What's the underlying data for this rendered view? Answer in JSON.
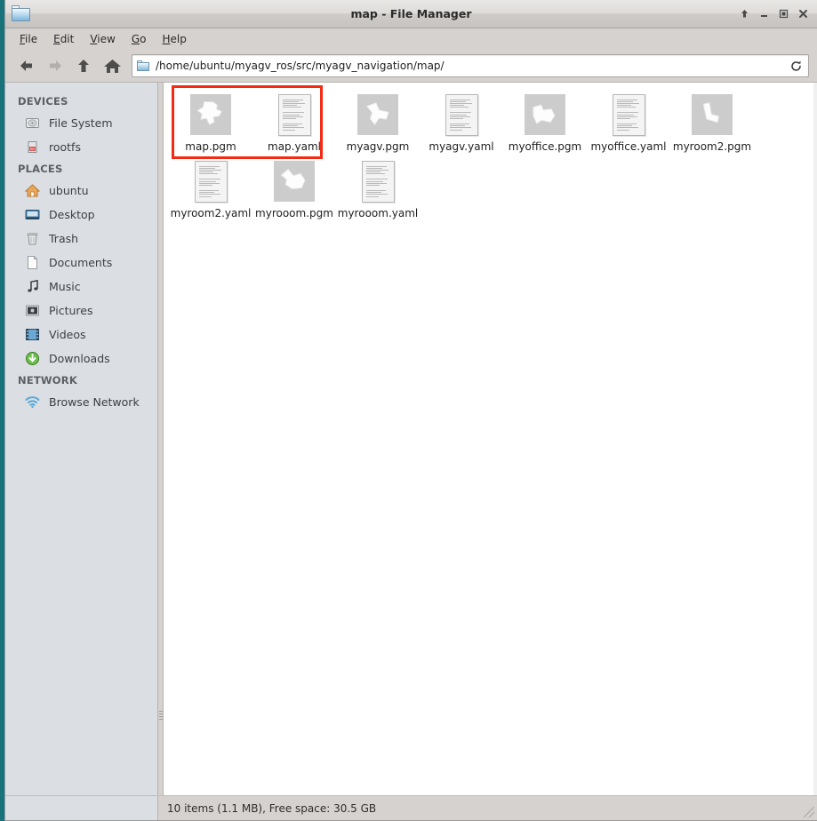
{
  "window": {
    "title": "map - File Manager",
    "icon": "folder-icon",
    "buttons": [
      {
        "name": "shade-button",
        "glyph": "arrow-up"
      },
      {
        "name": "minimize-button",
        "glyph": "minimize"
      },
      {
        "name": "maximize-button",
        "glyph": "maximize"
      },
      {
        "name": "close-button",
        "glyph": "close"
      }
    ]
  },
  "menubar": {
    "items": [
      {
        "mnemonic": "F",
        "rest": "ile"
      },
      {
        "mnemonic": "E",
        "rest": "dit"
      },
      {
        "mnemonic": "V",
        "rest": "iew"
      },
      {
        "mnemonic": "G",
        "rest": "o"
      },
      {
        "mnemonic": "H",
        "rest": "elp"
      }
    ]
  },
  "toolbar": {
    "back": {
      "label": "Back",
      "icon": "arrow-left-icon",
      "enabled": true
    },
    "forward": {
      "label": "Forward",
      "icon": "arrow-right-icon",
      "enabled": false
    },
    "up": {
      "label": "Up",
      "icon": "arrow-up-icon",
      "enabled": true
    },
    "home": {
      "label": "Home",
      "icon": "home-icon",
      "enabled": true
    },
    "reload": {
      "label": "Reload",
      "icon": "reload-icon"
    },
    "path": "/home/ubuntu/myagv_ros/src/myagv_navigation/map/",
    "path_placeholder": "/"
  },
  "sidebar": {
    "groups": [
      {
        "title": "DEVICES",
        "items": [
          {
            "label": "File System",
            "icon": "harddisk-icon"
          },
          {
            "label": "rootfs",
            "icon": "sdcard-icon"
          }
        ]
      },
      {
        "title": "PLACES",
        "items": [
          {
            "label": "ubuntu",
            "icon": "home-icon"
          },
          {
            "label": "Desktop",
            "icon": "desktop-icon"
          },
          {
            "label": "Trash",
            "icon": "trash-icon"
          },
          {
            "label": "Documents",
            "icon": "document-icon"
          },
          {
            "label": "Music",
            "icon": "music-note-icon"
          },
          {
            "label": "Pictures",
            "icon": "picture-icon"
          },
          {
            "label": "Videos",
            "icon": "film-icon"
          },
          {
            "label": "Downloads",
            "icon": "download-icon"
          }
        ]
      },
      {
        "title": "NETWORK",
        "items": [
          {
            "label": "Browse Network",
            "icon": "network-wifi-icon"
          }
        ]
      }
    ]
  },
  "files": [
    {
      "name": "map.pgm",
      "type": "pgm",
      "selected": true,
      "thumb": "map-thumbnail"
    },
    {
      "name": "map.yaml",
      "type": "yaml",
      "selected": true,
      "thumb": "text-document"
    },
    {
      "name": "myagv.pgm",
      "type": "pgm",
      "selected": false,
      "thumb": "map-thumbnail"
    },
    {
      "name": "myagv.yaml",
      "type": "yaml",
      "selected": false,
      "thumb": "text-document"
    },
    {
      "name": "myoffice.pgm",
      "type": "pgm",
      "selected": false,
      "thumb": "map-thumbnail"
    },
    {
      "name": "myoffice.yaml",
      "type": "yaml",
      "selected": false,
      "thumb": "text-document"
    },
    {
      "name": "myroom2.pgm",
      "type": "pgm",
      "selected": false,
      "thumb": "map-thumbnail"
    },
    {
      "name": "myroom2.yaml",
      "type": "yaml",
      "selected": false,
      "thumb": "text-document"
    },
    {
      "name": "myrooom.pgm",
      "type": "pgm",
      "selected": false,
      "thumb": "map-thumbnail"
    },
    {
      "name": "myrooom.yaml",
      "type": "yaml",
      "selected": false,
      "thumb": "text-document"
    }
  ],
  "annotation": {
    "name": "red-highlight-box",
    "color": "#f42b12",
    "covers": "map.pgm and map.yaml"
  },
  "statusbar": {
    "text": "10 items (1.1 MB), Free space: 30.5 GB",
    "item_count": 10,
    "total_size": "1.1 MB",
    "free_space": "30.5 GB"
  },
  "colors": {
    "desktop": "#17727a",
    "chrome": "#d6d2d0",
    "sidebar": "#dbdee3",
    "content": "#ffffff",
    "highlight": "#f42b12"
  }
}
